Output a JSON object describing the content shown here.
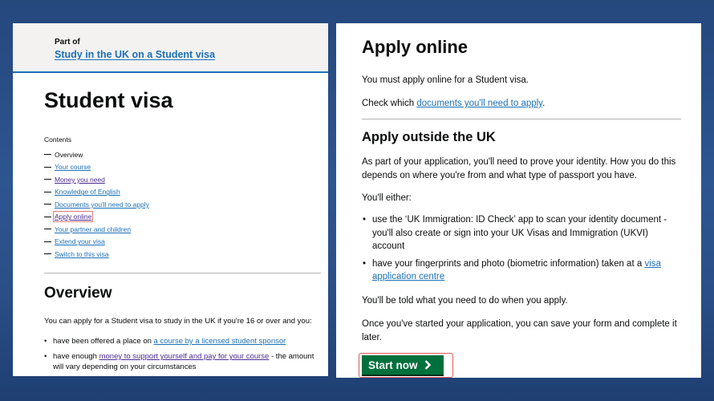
{
  "left": {
    "part_of": "Part of",
    "part_of_link": "Study in the UK on a Student visa",
    "title": "Student visa",
    "contents_label": "Contents",
    "toc": [
      {
        "label": "Overview",
        "link": false,
        "visited": false
      },
      {
        "label": "Your course",
        "link": true,
        "visited": false
      },
      {
        "label": "Money you need",
        "link": true,
        "visited": true
      },
      {
        "label": "Knowledge of English",
        "link": true,
        "visited": false
      },
      {
        "label": "Documents you'll need to apply",
        "link": true,
        "visited": false
      },
      {
        "label": "Apply online",
        "link": true,
        "visited": true,
        "focused": true
      },
      {
        "label": "Your partner and children",
        "link": true,
        "visited": false
      },
      {
        "label": "Extend your visa",
        "link": true,
        "visited": false
      },
      {
        "label": "Switch to this visa",
        "link": true,
        "visited": false
      }
    ],
    "overview_heading": "Overview",
    "overview_text": "You can apply for a Student visa to study in the UK if you're 16 or over and you:",
    "bullets": {
      "b1_pre": "have been offered a place on ",
      "b1_link": "a course by a licensed student sponsor",
      "b2_pre": "have enough ",
      "b2_link": "money to support yourself and pay for your course",
      "b2_post": " - the amount will vary depending on your circumstances"
    }
  },
  "right": {
    "title": "Apply online",
    "intro": "You must apply online for a Student visa.",
    "check_pre": "Check which ",
    "check_link": "documents you'll need to apply",
    "check_post": ".",
    "outside_heading": "Apply outside the UK",
    "outside_text": "As part of your application, you'll need to prove your identity. How you do this depends on where you're from and what type of passport you have.",
    "either": "You'll either:",
    "bullet1": "use the ‘UK Immigration: ID Check’ app to scan your identity document - you'll also create or sign into your UK Visas and Immigration (UKVI) account",
    "bullet2_pre": "have your fingerprints and photo (biometric information) taken at a ",
    "bullet2_link": "visa application centre",
    "told": "You'll be told what you need to do when you apply.",
    "save": "Once you've started your application, you can save your form and complete it later.",
    "start_button": "Start now"
  },
  "colors": {
    "link": "#1d70b8",
    "visited_link": "#4c2c92",
    "start_button": "#00703c",
    "focus_outline": "#e05a5a",
    "background": "#2d5590"
  },
  "icons": {
    "start_arrow": "chevron-right-icon",
    "toc_bullet": "em-dash"
  }
}
